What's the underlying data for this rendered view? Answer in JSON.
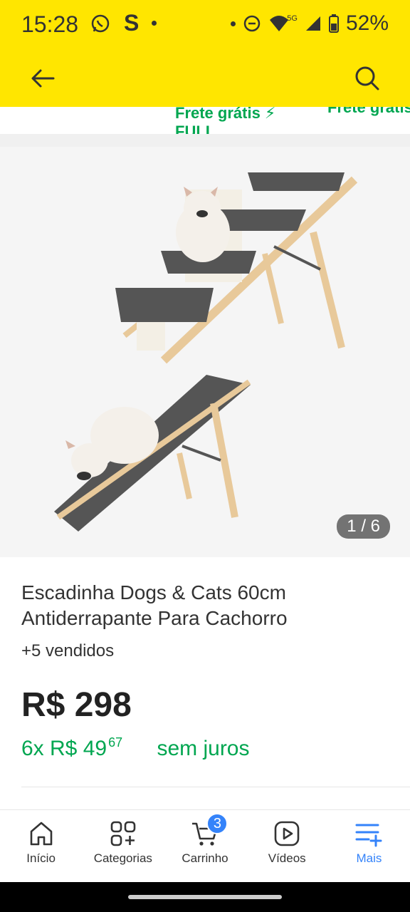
{
  "status": {
    "time": "15:28",
    "battery": "52%",
    "network": "5G"
  },
  "header": {
    "back_icon": "arrow-left-icon",
    "search_icon": "search-icon"
  },
  "promo": {
    "left": "Frete grátis ⚡ FULL",
    "right": "Frete grátis"
  },
  "gallery": {
    "counter": "1 / 6"
  },
  "product": {
    "title": "Escadinha Dogs & Cats 60cm Antiderrapante Para Cachorro",
    "sold": "+5 vendidos",
    "price": "R$ 298",
    "installments_prefix": "6x R$ 49",
    "installments_cents": "67",
    "installments_suffix": "sem juros"
  },
  "nav": {
    "items": [
      {
        "label": "Início",
        "icon": "home-icon"
      },
      {
        "label": "Categorias",
        "icon": "categories-icon"
      },
      {
        "label": "Carrinho",
        "icon": "cart-icon",
        "badge": "3"
      },
      {
        "label": "Vídeos",
        "icon": "video-icon"
      },
      {
        "label": "Mais",
        "icon": "more-icon"
      }
    ]
  },
  "colors": {
    "brand_yellow": "#ffe600",
    "green": "#00a650",
    "blue": "#3483fa"
  }
}
